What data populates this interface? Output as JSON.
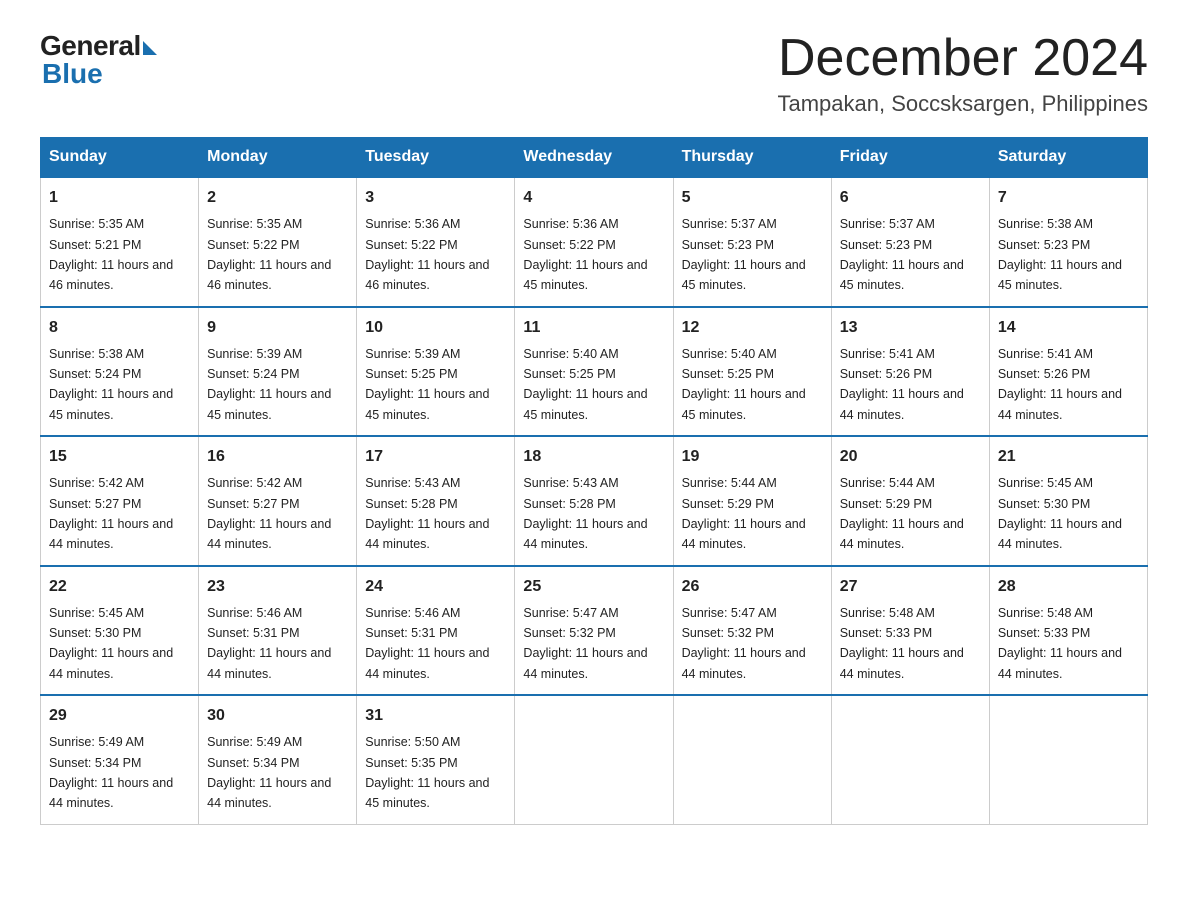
{
  "logo": {
    "general": "General",
    "blue": "Blue"
  },
  "title": {
    "month_year": "December 2024",
    "location": "Tampakan, Soccsksargen, Philippines"
  },
  "weekdays": [
    "Sunday",
    "Monday",
    "Tuesday",
    "Wednesday",
    "Thursday",
    "Friday",
    "Saturday"
  ],
  "weeks": [
    [
      {
        "day": "1",
        "sunrise": "5:35 AM",
        "sunset": "5:21 PM",
        "daylight": "11 hours and 46 minutes."
      },
      {
        "day": "2",
        "sunrise": "5:35 AM",
        "sunset": "5:22 PM",
        "daylight": "11 hours and 46 minutes."
      },
      {
        "day": "3",
        "sunrise": "5:36 AM",
        "sunset": "5:22 PM",
        "daylight": "11 hours and 46 minutes."
      },
      {
        "day": "4",
        "sunrise": "5:36 AM",
        "sunset": "5:22 PM",
        "daylight": "11 hours and 45 minutes."
      },
      {
        "day": "5",
        "sunrise": "5:37 AM",
        "sunset": "5:23 PM",
        "daylight": "11 hours and 45 minutes."
      },
      {
        "day": "6",
        "sunrise": "5:37 AM",
        "sunset": "5:23 PM",
        "daylight": "11 hours and 45 minutes."
      },
      {
        "day": "7",
        "sunrise": "5:38 AM",
        "sunset": "5:23 PM",
        "daylight": "11 hours and 45 minutes."
      }
    ],
    [
      {
        "day": "8",
        "sunrise": "5:38 AM",
        "sunset": "5:24 PM",
        "daylight": "11 hours and 45 minutes."
      },
      {
        "day": "9",
        "sunrise": "5:39 AM",
        "sunset": "5:24 PM",
        "daylight": "11 hours and 45 minutes."
      },
      {
        "day": "10",
        "sunrise": "5:39 AM",
        "sunset": "5:25 PM",
        "daylight": "11 hours and 45 minutes."
      },
      {
        "day": "11",
        "sunrise": "5:40 AM",
        "sunset": "5:25 PM",
        "daylight": "11 hours and 45 minutes."
      },
      {
        "day": "12",
        "sunrise": "5:40 AM",
        "sunset": "5:25 PM",
        "daylight": "11 hours and 45 minutes."
      },
      {
        "day": "13",
        "sunrise": "5:41 AM",
        "sunset": "5:26 PM",
        "daylight": "11 hours and 44 minutes."
      },
      {
        "day": "14",
        "sunrise": "5:41 AM",
        "sunset": "5:26 PM",
        "daylight": "11 hours and 44 minutes."
      }
    ],
    [
      {
        "day": "15",
        "sunrise": "5:42 AM",
        "sunset": "5:27 PM",
        "daylight": "11 hours and 44 minutes."
      },
      {
        "day": "16",
        "sunrise": "5:42 AM",
        "sunset": "5:27 PM",
        "daylight": "11 hours and 44 minutes."
      },
      {
        "day": "17",
        "sunrise": "5:43 AM",
        "sunset": "5:28 PM",
        "daylight": "11 hours and 44 minutes."
      },
      {
        "day": "18",
        "sunrise": "5:43 AM",
        "sunset": "5:28 PM",
        "daylight": "11 hours and 44 minutes."
      },
      {
        "day": "19",
        "sunrise": "5:44 AM",
        "sunset": "5:29 PM",
        "daylight": "11 hours and 44 minutes."
      },
      {
        "day": "20",
        "sunrise": "5:44 AM",
        "sunset": "5:29 PM",
        "daylight": "11 hours and 44 minutes."
      },
      {
        "day": "21",
        "sunrise": "5:45 AM",
        "sunset": "5:30 PM",
        "daylight": "11 hours and 44 minutes."
      }
    ],
    [
      {
        "day": "22",
        "sunrise": "5:45 AM",
        "sunset": "5:30 PM",
        "daylight": "11 hours and 44 minutes."
      },
      {
        "day": "23",
        "sunrise": "5:46 AM",
        "sunset": "5:31 PM",
        "daylight": "11 hours and 44 minutes."
      },
      {
        "day": "24",
        "sunrise": "5:46 AM",
        "sunset": "5:31 PM",
        "daylight": "11 hours and 44 minutes."
      },
      {
        "day": "25",
        "sunrise": "5:47 AM",
        "sunset": "5:32 PM",
        "daylight": "11 hours and 44 minutes."
      },
      {
        "day": "26",
        "sunrise": "5:47 AM",
        "sunset": "5:32 PM",
        "daylight": "11 hours and 44 minutes."
      },
      {
        "day": "27",
        "sunrise": "5:48 AM",
        "sunset": "5:33 PM",
        "daylight": "11 hours and 44 minutes."
      },
      {
        "day": "28",
        "sunrise": "5:48 AM",
        "sunset": "5:33 PM",
        "daylight": "11 hours and 44 minutes."
      }
    ],
    [
      {
        "day": "29",
        "sunrise": "5:49 AM",
        "sunset": "5:34 PM",
        "daylight": "11 hours and 44 minutes."
      },
      {
        "day": "30",
        "sunrise": "5:49 AM",
        "sunset": "5:34 PM",
        "daylight": "11 hours and 44 minutes."
      },
      {
        "day": "31",
        "sunrise": "5:50 AM",
        "sunset": "5:35 PM",
        "daylight": "11 hours and 45 minutes."
      },
      null,
      null,
      null,
      null
    ]
  ],
  "labels": {
    "sunrise": "Sunrise: ",
    "sunset": "Sunset: ",
    "daylight": "Daylight: "
  }
}
